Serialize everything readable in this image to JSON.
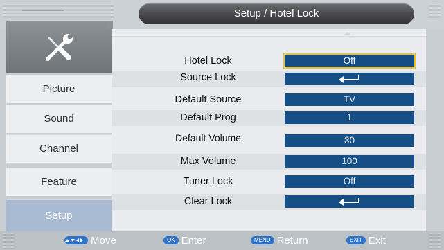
{
  "header": {
    "title": "Setup / Hotel Lock"
  },
  "sidebar": {
    "icon": "tools-icon",
    "items": [
      {
        "label": "Picture"
      },
      {
        "label": "Sound"
      },
      {
        "label": "Channel"
      },
      {
        "label": "Feature"
      },
      {
        "label": "Setup",
        "active": true
      }
    ]
  },
  "settings": [
    {
      "label": "Hotel Lock",
      "value": "Off",
      "focused": true
    },
    {
      "label": "Source Lock",
      "value": "",
      "icon": "enter-arrow-icon"
    },
    {
      "label": "Default Source",
      "value": "TV"
    },
    {
      "label": "Default Prog",
      "value": "1"
    },
    {
      "label": "Default Volume",
      "value": "30"
    },
    {
      "label": "Max Volume",
      "value": "100"
    },
    {
      "label": "Tuner Lock",
      "value": "Off"
    },
    {
      "label": "Clear Lock",
      "value": "",
      "icon": "enter-arrow-icon"
    }
  ],
  "footer": {
    "move": {
      "label": "Move",
      "key_icon": "arrow-keys-icon"
    },
    "enter": {
      "key": "OK",
      "label": "Enter"
    },
    "return": {
      "key": "MENU",
      "label": "Return"
    },
    "exit": {
      "key": "EXIT",
      "label": "Exit"
    }
  },
  "colors": {
    "value_box": "#164f86",
    "focus_outline": "#f2c21c",
    "active_sidebar": "#a8bbd2",
    "key_pill": "#2f73c8"
  }
}
